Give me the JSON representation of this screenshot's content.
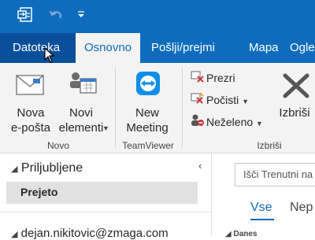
{
  "titlebar": {
    "icons": [
      "send-receive-icon",
      "undo-icon",
      "customize-quick-access-icon"
    ]
  },
  "tabs": [
    {
      "label": "Datoteka"
    },
    {
      "label": "Osnovno"
    },
    {
      "label": "Pošlji/prejmi"
    },
    {
      "label": "Mapa"
    },
    {
      "label": "Ogle"
    }
  ],
  "ribbon": {
    "new_group": {
      "new_email_line1": "Nova",
      "new_email_line2": "e-pošta",
      "new_items_line1": "Novi",
      "new_items_line2": "elementi",
      "label": "Novo"
    },
    "teamviewer_group": {
      "new_meeting_line1": "New",
      "new_meeting_line2": "Meeting",
      "label": "TeamViewer"
    },
    "delete_group": {
      "ignore": "Prezri",
      "clean_up": "Počisti",
      "junk": "Neželeno",
      "delete": "Izbriši",
      "label": "Izbriši"
    }
  },
  "nav": {
    "favorites": "Priljubljene",
    "inbox": "Prejeto",
    "account": "dejan.nikitovic@zmaga.com"
  },
  "mail_list": {
    "search_placeholder": "Išči Trenutni na",
    "filter_all": "Vse",
    "filter_unread": "Nep",
    "group_today": "Danes"
  },
  "colors": {
    "accent": "#0f6cbd",
    "file_tab": "#0b4f9b",
    "ribbon_bg": "#f3f3f3",
    "selected_item": "#e1e1e1"
  }
}
